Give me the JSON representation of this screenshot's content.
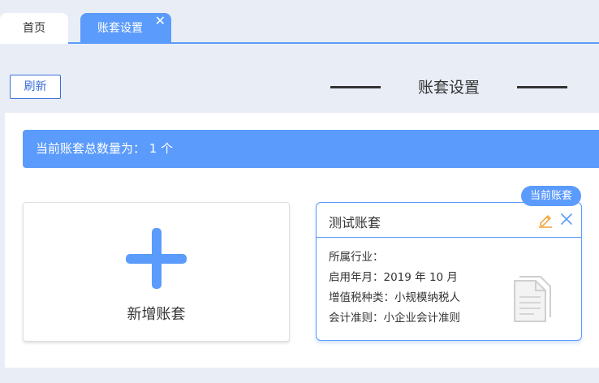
{
  "tabs": [
    {
      "label": "首页",
      "active": false
    },
    {
      "label": "账套设置",
      "active": true,
      "close_glyph": "✕"
    }
  ],
  "toolbar": {
    "refresh_label": "刷新"
  },
  "page": {
    "title": "账套设置"
  },
  "summary": {
    "count_text": "当前账套总数量为： 1 个"
  },
  "add_card": {
    "label": "新增账套",
    "icon": "plus-icon"
  },
  "ledger": {
    "name": "测试账套",
    "badge": "当前账套",
    "industry": "所属行业：",
    "start_date": "启用年月：2019 年 10 月",
    "vat_type": "增值税种类：小规模纳税人",
    "accounting_standard": "会计准则：小企业会计准则",
    "icons": [
      "edit-icon",
      "close-icon",
      "document-icon"
    ]
  },
  "colors": {
    "accent": "#5b9bfb",
    "edit_orange": "#f0a030",
    "background": "#e9eef6"
  }
}
